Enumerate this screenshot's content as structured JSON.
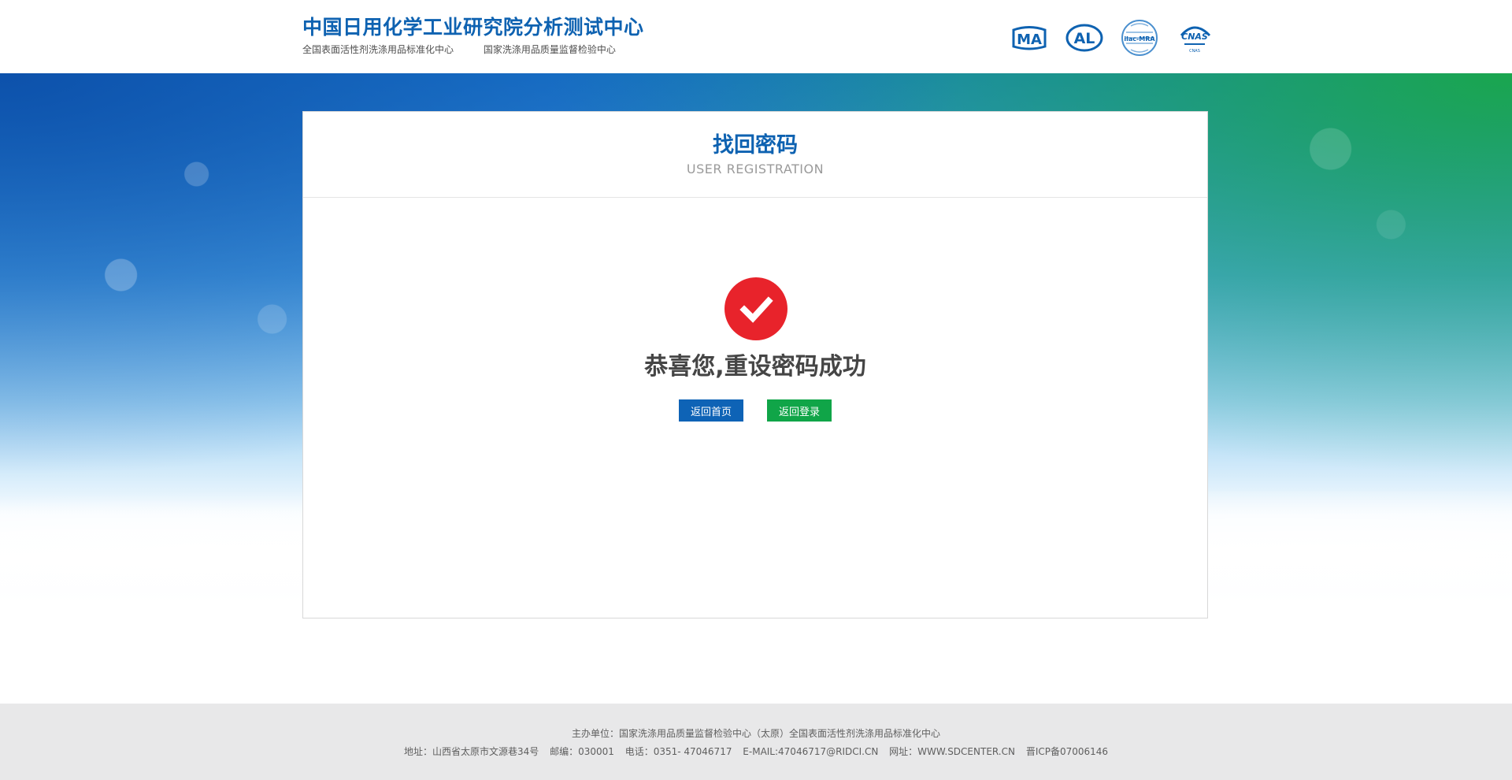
{
  "header": {
    "title": "中国日用化学工业研究院分析测试中心",
    "subtitles": [
      "全国表面活性剂洗涤用品标准化中心",
      "国家洗涤用品质量监督检验中心"
    ],
    "certifications": [
      {
        "label": "MA",
        "icon": "cma-icon"
      },
      {
        "label": "AL",
        "icon": "cal-icon"
      },
      {
        "label": "ilac-MRA",
        "icon": "ilac-mra-icon"
      },
      {
        "label": "CNAS",
        "icon": "cnas-icon"
      }
    ]
  },
  "card": {
    "title": "找回密码",
    "subtitle": "USER REGISTRATION",
    "success_message": "恭喜您,重设密码成功",
    "buttons": {
      "home": "返回首页",
      "login": "返回登录"
    }
  },
  "footer": {
    "line1": "主办单位：国家洗涤用品质量监督检验中心（太原）全国表面活性剂洗涤用品标准化中心",
    "address": "地址：山西省太原市文源巷34号",
    "postcode": "邮编：030001",
    "phone": "电话：0351- 47046717",
    "email": "E-MAIL:47046717@RIDCI.CN",
    "website": "网址：WWW.SDCENTER.CN",
    "icp": "晋ICP备07006146"
  },
  "colors": {
    "brand_blue": "#0e62b1",
    "success_red": "#e8232b",
    "button_green": "#10a548",
    "footer_bg": "#e8e8e9"
  }
}
